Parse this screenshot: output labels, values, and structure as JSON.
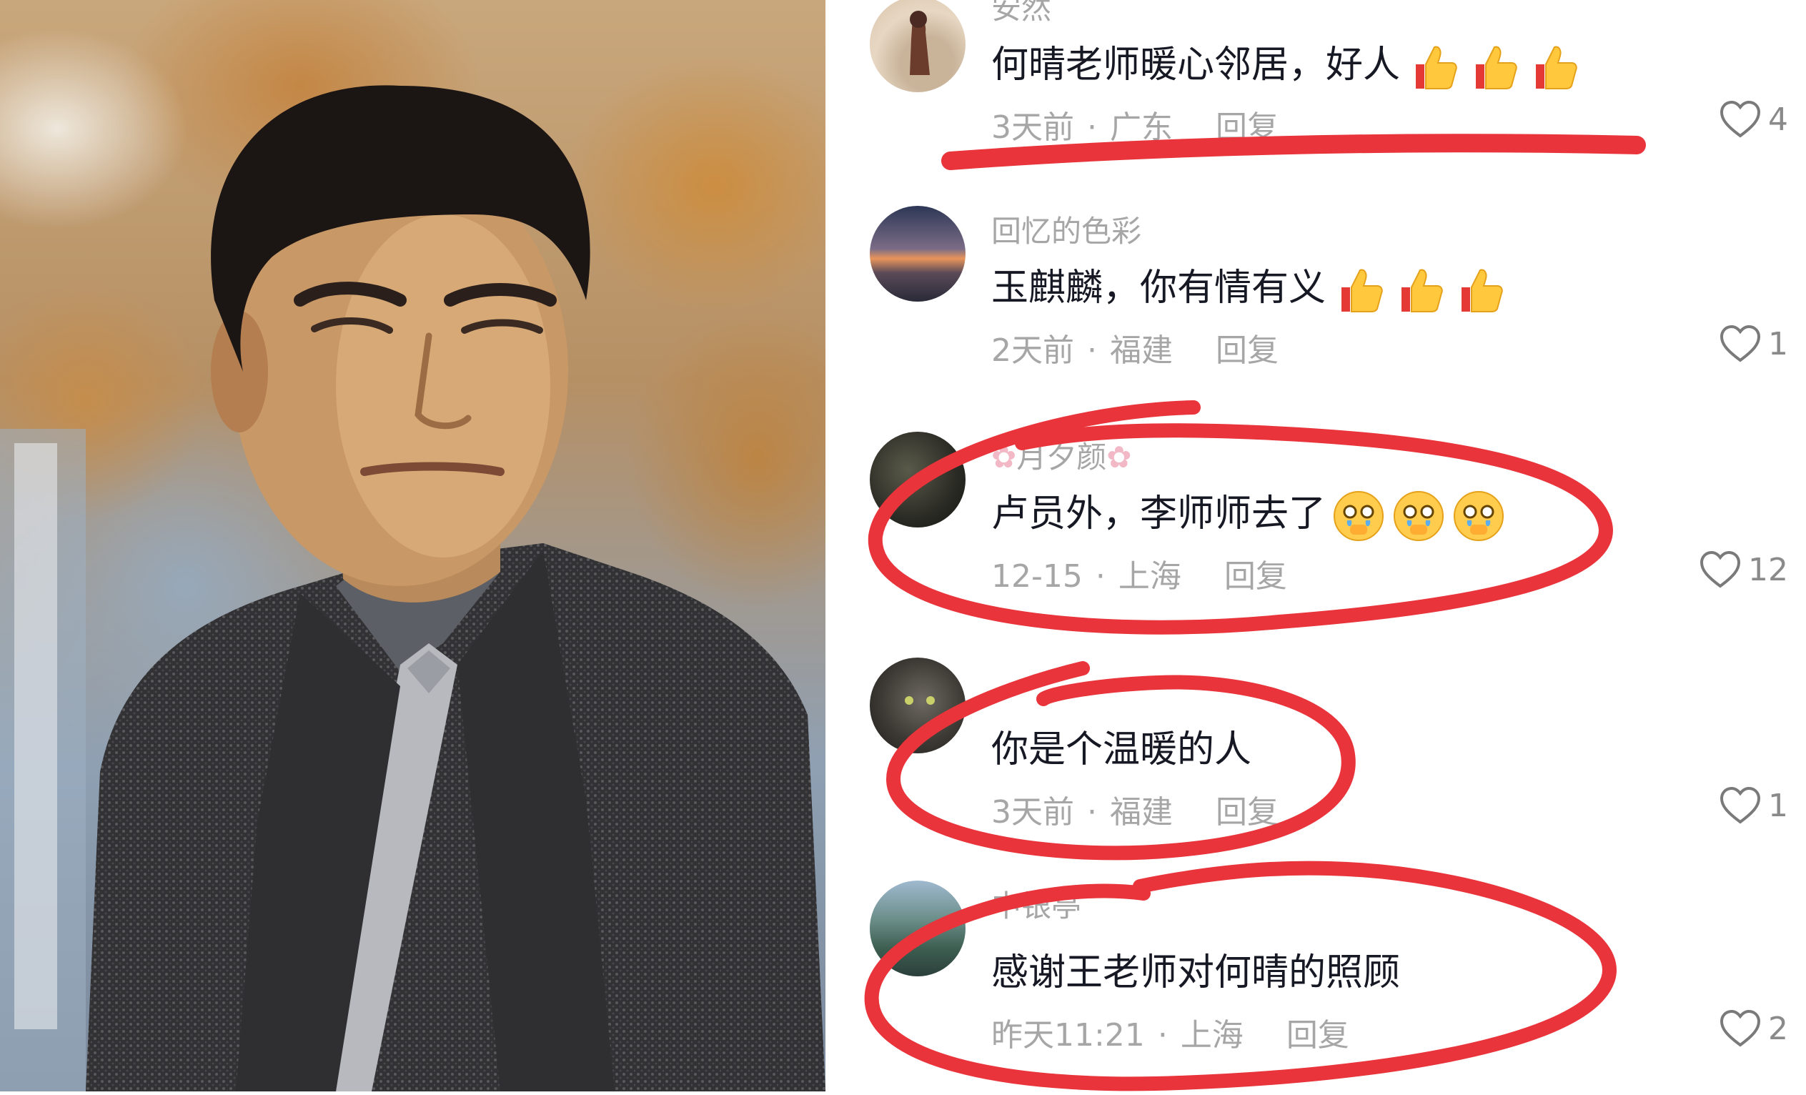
{
  "comments": [
    {
      "username": "安然",
      "text": "何晴老师暖心邻居，好人",
      "emojis": [
        "thumbs-up-icon",
        "thumbs-up-icon",
        "thumbs-up-icon"
      ],
      "time": "3天前",
      "location": "广东",
      "reply": "回复",
      "likes": "4"
    },
    {
      "username": "回忆的色彩",
      "text": "玉麒麟，你有情有义",
      "emojis": [
        "thumbs-up-icon",
        "thumbs-up-icon",
        "thumbs-up-icon"
      ],
      "time": "2天前",
      "location": "福建",
      "reply": "回复",
      "likes": "1"
    },
    {
      "username": "月夕颜",
      "text": "卢员外，李师师去了",
      "emojis": [
        "crying-face-icon",
        "crying-face-icon",
        "crying-face-icon"
      ],
      "time": "12-15",
      "location": "上海",
      "reply": "回复",
      "likes": "12"
    },
    {
      "username": "",
      "text": "你是个温暖的人",
      "emojis": [],
      "time": "3天前",
      "location": "福建",
      "reply": "回复",
      "likes": "1"
    },
    {
      "username": "中银亭",
      "text": "感谢王老师对何晴的照顾",
      "emojis": [],
      "time": "昨天11:21",
      "location": "上海",
      "reply": "回复",
      "likes": "2"
    }
  ],
  "colors": {
    "annotation_red": "#e8343a",
    "text_primary": "#161823",
    "text_secondary": "#a6a6a6"
  }
}
